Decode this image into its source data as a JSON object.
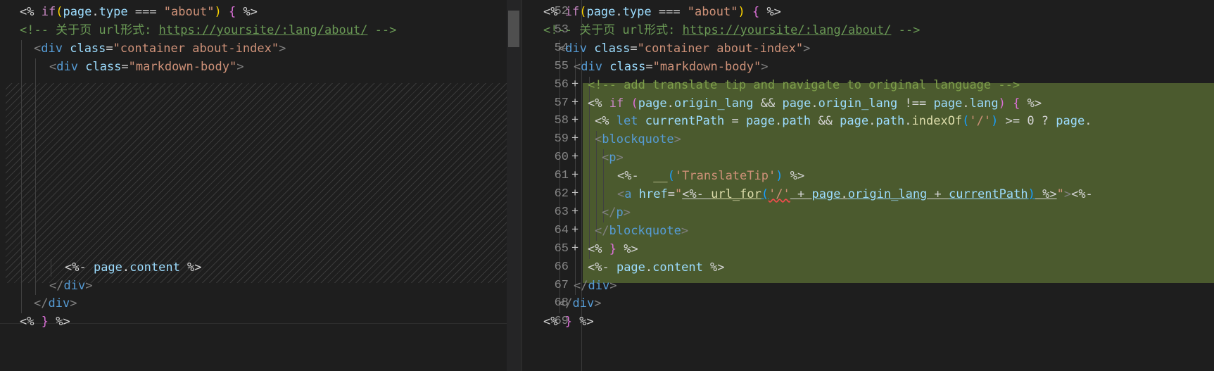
{
  "left": {
    "lines": [
      {
        "parts": [
          [
            "k",
            "<% "
          ],
          [
            "kw",
            "if"
          ],
          [
            "br",
            "("
          ],
          [
            "vr",
            "page"
          ],
          [
            "k",
            "."
          ],
          [
            "vr",
            "type"
          ],
          [
            "k",
            " === "
          ],
          [
            "st",
            "\"about\""
          ],
          [
            "br",
            ")"
          ],
          [
            "k",
            " "
          ],
          [
            "br2",
            "{"
          ],
          [
            "k",
            " %>"
          ]
        ]
      },
      {
        "parts": [
          [
            "cm",
            "<!-- 关于页 url形式: "
          ],
          [
            "cmu",
            "https://yoursite/:lang/about/"
          ],
          [
            "cm",
            " -->"
          ]
        ]
      },
      {
        "parts": [
          [
            "tgd",
            "<"
          ],
          [
            "tg",
            "div"
          ],
          [
            "k",
            " "
          ],
          [
            "at",
            "class"
          ],
          [
            "k",
            "="
          ],
          [
            "av",
            "\"container about-index\""
          ],
          [
            "tgd",
            ">"
          ]
        ]
      },
      {
        "parts": [
          [
            "tgd",
            "<"
          ],
          [
            "tg",
            "div"
          ],
          [
            "k",
            " "
          ],
          [
            "at",
            "class"
          ],
          [
            "k",
            "="
          ],
          [
            "av",
            "\"markdown-body\""
          ],
          [
            "tgd",
            ">"
          ]
        ]
      },
      {
        "parts": [
          [
            "k",
            "<%- "
          ],
          [
            "vr",
            "page"
          ],
          [
            "k",
            "."
          ],
          [
            "vr",
            "content"
          ],
          [
            "k",
            " %>"
          ]
        ]
      },
      {
        "parts": [
          [
            "tgd",
            "</"
          ],
          [
            "tg",
            "div"
          ],
          [
            "tgd",
            ">"
          ]
        ]
      },
      {
        "parts": [
          [
            "tgd",
            "</"
          ],
          [
            "tg",
            "div"
          ],
          [
            "tgd",
            ">"
          ]
        ]
      },
      {
        "parts": [
          [
            "k",
            "<% "
          ],
          [
            "br2",
            "}"
          ],
          [
            "k",
            " %>"
          ]
        ]
      }
    ]
  },
  "right": {
    "line_numbers": [
      "52",
      "53",
      "54",
      "55",
      "56",
      "57",
      "58",
      "59",
      "60",
      "61",
      "62",
      "63",
      "64",
      "65",
      "66",
      "67",
      "68",
      "69"
    ],
    "added_marker": "+",
    "lines": [
      {
        "parts": [
          [
            "k",
            "<% "
          ],
          [
            "kw",
            "if"
          ],
          [
            "br",
            "("
          ],
          [
            "vr",
            "page"
          ],
          [
            "k",
            "."
          ],
          [
            "vr",
            "type"
          ],
          [
            "k",
            " === "
          ],
          [
            "st",
            "\"about\""
          ],
          [
            "br",
            ")"
          ],
          [
            "k",
            " "
          ],
          [
            "br2",
            "{"
          ],
          [
            "k",
            " %>"
          ]
        ]
      },
      {
        "parts": [
          [
            "cm",
            "<!-- 关于页 url形式: "
          ],
          [
            "cmu",
            "https://yoursite/:lang/about/"
          ],
          [
            "cm",
            " -->"
          ]
        ]
      },
      {
        "parts": [
          [
            "tgd",
            "<"
          ],
          [
            "tg",
            "div"
          ],
          [
            "k",
            " "
          ],
          [
            "at",
            "class"
          ],
          [
            "k",
            "="
          ],
          [
            "av",
            "\"container about-index\""
          ],
          [
            "tgd",
            ">"
          ]
        ]
      },
      {
        "parts": [
          [
            "tgd",
            "<"
          ],
          [
            "tg",
            "div"
          ],
          [
            "k",
            " "
          ],
          [
            "at",
            "class"
          ],
          [
            "k",
            "="
          ],
          [
            "av",
            "\"markdown-body\""
          ],
          [
            "tgd",
            ">"
          ]
        ]
      },
      {
        "parts": [
          [
            "cmd",
            "<!-- add translate tip and navigate to original language -->"
          ]
        ]
      },
      {
        "parts": [
          [
            "k",
            "<% "
          ],
          [
            "kw",
            "if"
          ],
          [
            "k",
            " "
          ],
          [
            "br2",
            "("
          ],
          [
            "vr",
            "page"
          ],
          [
            "k",
            "."
          ],
          [
            "vr",
            "origin_lang"
          ],
          [
            "k",
            " && "
          ],
          [
            "vr",
            "page"
          ],
          [
            "k",
            "."
          ],
          [
            "vr",
            "origin_lang"
          ],
          [
            "k",
            " !== "
          ],
          [
            "vr",
            "page"
          ],
          [
            "k",
            "."
          ],
          [
            "vr",
            "lang"
          ],
          [
            "br2",
            ")"
          ],
          [
            "k",
            " "
          ],
          [
            "br2",
            "{"
          ],
          [
            "k",
            " %>"
          ]
        ]
      },
      {
        "parts": [
          [
            "k",
            "<% "
          ],
          [
            "tg",
            "let"
          ],
          [
            "k",
            " "
          ],
          [
            "vr",
            "currentPath"
          ],
          [
            "k",
            " = "
          ],
          [
            "vr",
            "page"
          ],
          [
            "k",
            "."
          ],
          [
            "vr",
            "path"
          ],
          [
            "k",
            " && "
          ],
          [
            "vr",
            "page"
          ],
          [
            "k",
            "."
          ],
          [
            "vr",
            "path"
          ],
          [
            "k",
            "."
          ],
          [
            "fn",
            "indexOf"
          ],
          [
            "br3",
            "("
          ],
          [
            "st",
            "'/'"
          ],
          [
            "br3",
            ")"
          ],
          [
            "k",
            " >= 0 ? "
          ],
          [
            "vr",
            "page"
          ],
          [
            "k",
            "."
          ]
        ]
      },
      {
        "parts": [
          [
            "tgd",
            "<"
          ],
          [
            "tg",
            "blockquote"
          ],
          [
            "tgd",
            ">"
          ]
        ]
      },
      {
        "parts": [
          [
            "tgd",
            "<"
          ],
          [
            "tg",
            "p"
          ],
          [
            "tgd",
            ">"
          ]
        ]
      },
      {
        "parts": [
          [
            "k",
            "<%-  "
          ],
          [
            "fn",
            "__"
          ],
          [
            "br3",
            "("
          ],
          [
            "st",
            "'TranslateTip'"
          ],
          [
            "br3",
            ")"
          ],
          [
            "k",
            " %>"
          ]
        ]
      },
      {
        "parts": [
          [
            "tgd",
            "<"
          ],
          [
            "tg",
            "a"
          ],
          [
            "k",
            " "
          ],
          [
            "at",
            "href"
          ],
          [
            "k",
            "="
          ],
          [
            "av",
            "\""
          ],
          [
            "ku",
            "<%- "
          ],
          [
            "fnu",
            "url_for"
          ],
          [
            "br3u",
            "("
          ],
          [
            "stq",
            "'/'"
          ],
          [
            "ku",
            " + "
          ],
          [
            "vru",
            "page"
          ],
          [
            "ku",
            "."
          ],
          [
            "vru",
            "origin_lang"
          ],
          [
            "ku",
            " + "
          ],
          [
            "vru",
            "currentPath"
          ],
          [
            "br3u",
            ")"
          ],
          [
            "ku",
            " %>"
          ],
          [
            "av",
            "\""
          ],
          [
            "tgd",
            ">"
          ],
          [
            "k",
            "<%-"
          ]
        ]
      },
      {
        "parts": [
          [
            "tgd",
            "</"
          ],
          [
            "tg",
            "p"
          ],
          [
            "tgd",
            ">"
          ]
        ]
      },
      {
        "parts": [
          [
            "tgd",
            "</"
          ],
          [
            "tg",
            "blockquote"
          ],
          [
            "tgd",
            ">"
          ]
        ]
      },
      {
        "parts": [
          [
            "k",
            "<% "
          ],
          [
            "br2",
            "}"
          ],
          [
            "k",
            " %>"
          ]
        ]
      },
      {
        "parts": [
          [
            "k",
            "<%- "
          ],
          [
            "vr",
            "page"
          ],
          [
            "k",
            "."
          ],
          [
            "vr",
            "content"
          ],
          [
            "k",
            " %>"
          ]
        ]
      },
      {
        "parts": [
          [
            "tgd",
            "</"
          ],
          [
            "tg",
            "div"
          ],
          [
            "tgd",
            ">"
          ]
        ]
      },
      {
        "parts": [
          [
            "tgd",
            "</"
          ],
          [
            "tg",
            "div"
          ],
          [
            "tgd",
            ">"
          ]
        ]
      },
      {
        "parts": [
          [
            "k",
            "<% "
          ],
          [
            "br2",
            "}"
          ],
          [
            "k",
            " %>"
          ]
        ]
      }
    ]
  }
}
